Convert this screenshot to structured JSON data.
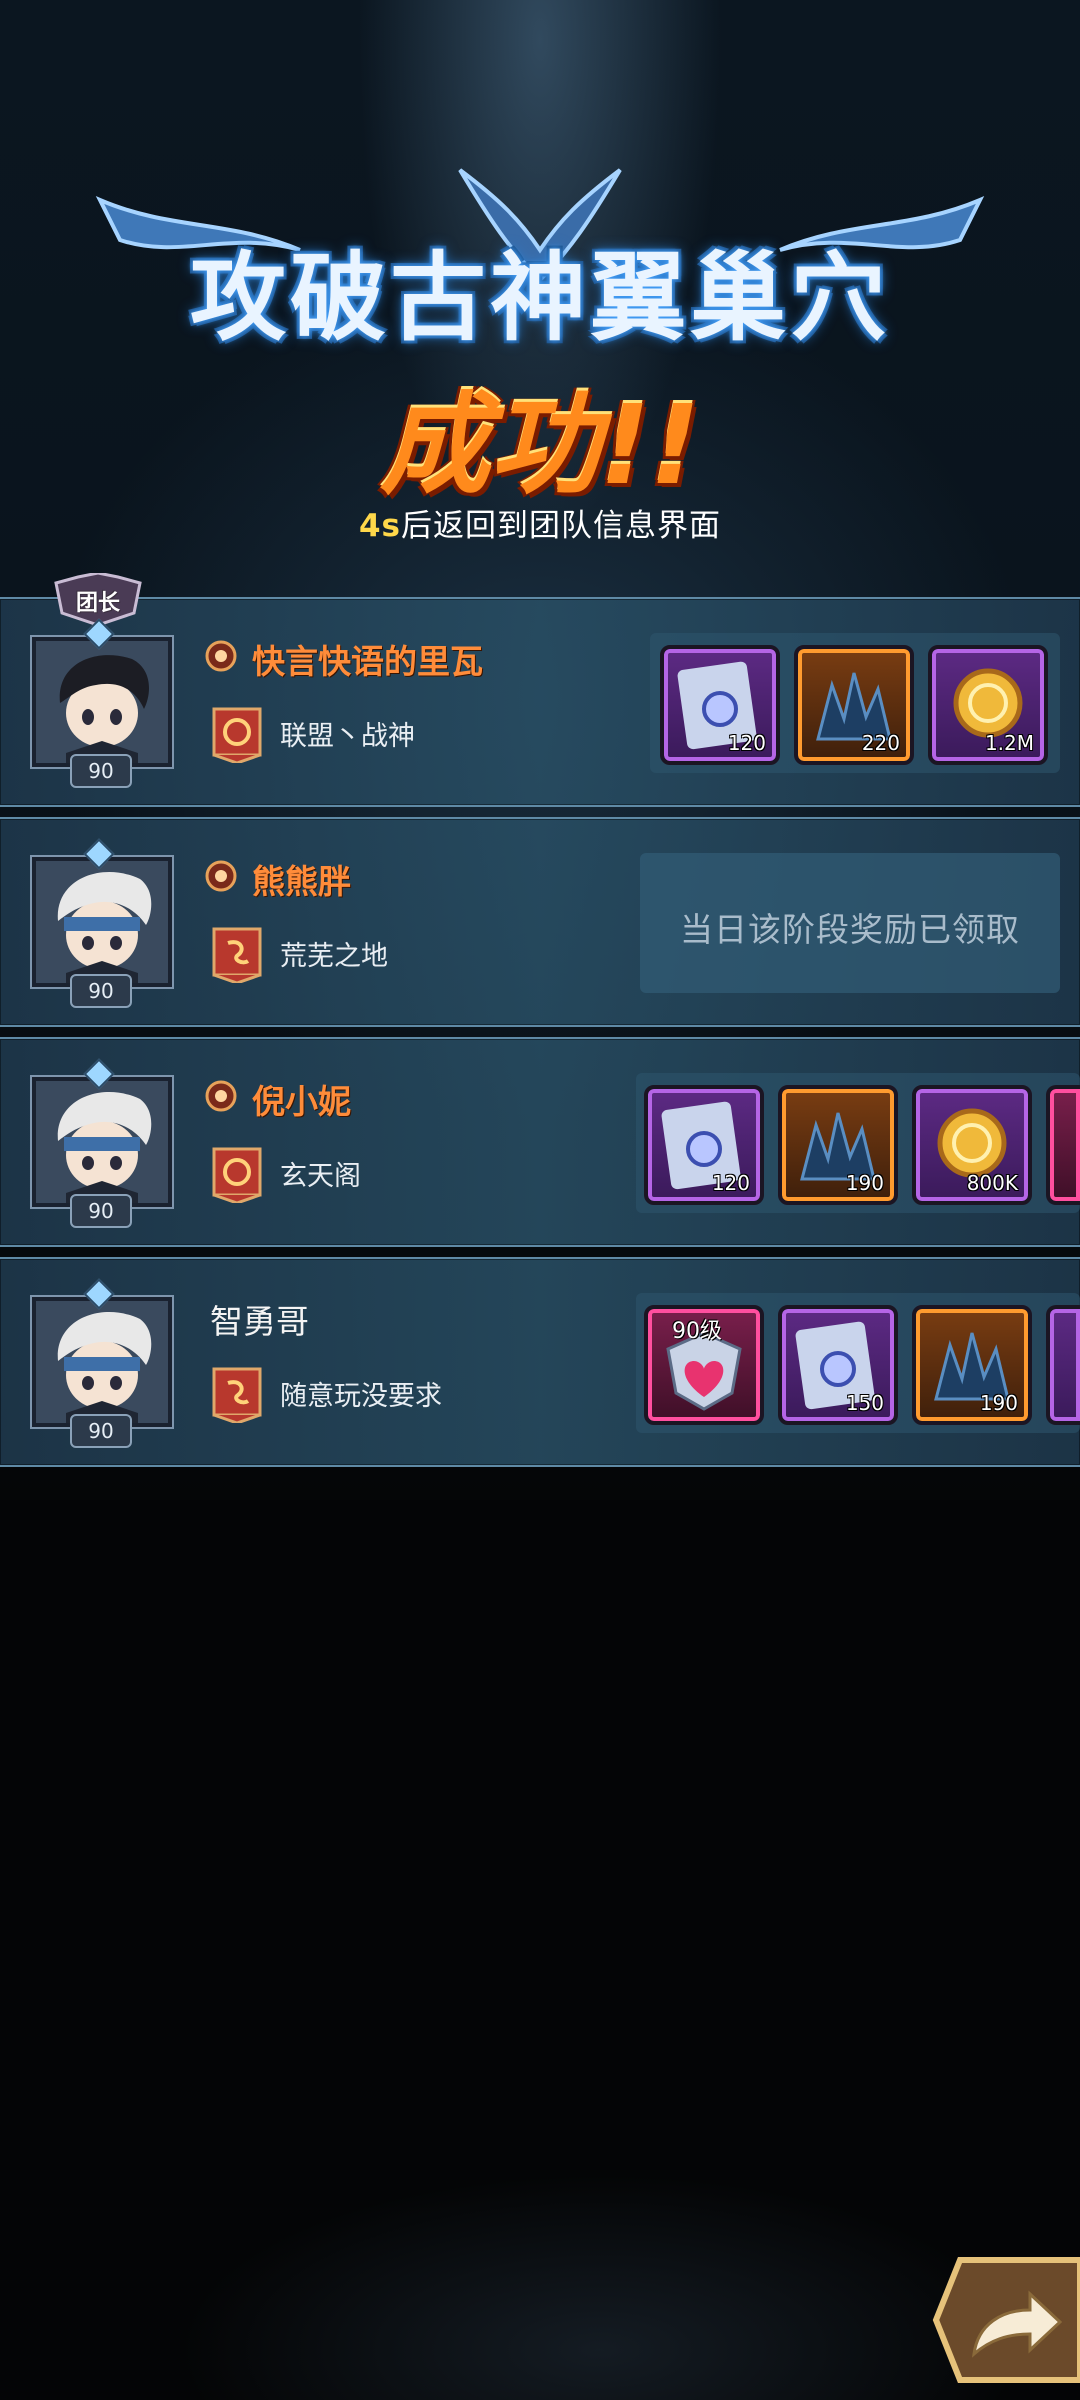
{
  "header": {
    "title": "攻破古神翼巢穴",
    "result": "成功!!",
    "countdown_seconds": "4s",
    "countdown_text": "后返回到团队信息界面"
  },
  "leader_badge": "团长",
  "players": [
    {
      "name": "快言快语的里瓦",
      "guild": "联盟丶战神",
      "level": "90",
      "rewards": [
        {
          "icon": "blueprint-scroll-icon",
          "qty": "120",
          "rarity": "purple"
        },
        {
          "icon": "dark-crystal-icon",
          "qty": "220",
          "rarity": "orange"
        },
        {
          "icon": "gold-coin-icon",
          "qty": "1.2M",
          "rarity": "purple"
        }
      ]
    },
    {
      "name": "熊熊胖",
      "guild": "荒芜之地",
      "level": "90",
      "claimed_text": "当日该阶段奖励已领取"
    },
    {
      "name": "倪小妮",
      "guild": "玄天阁",
      "level": "90",
      "rewards": [
        {
          "icon": "blueprint-scroll-icon",
          "qty": "120",
          "rarity": "purple"
        },
        {
          "icon": "dark-crystal-icon",
          "qty": "190",
          "rarity": "orange"
        },
        {
          "icon": "gold-coin-icon",
          "qty": "800K",
          "rarity": "purple"
        }
      ]
    },
    {
      "name": "智勇哥",
      "guild": "随意玩没要求",
      "level": "90",
      "rewards": [
        {
          "icon": "heart-equipment-icon",
          "level_tag": "90级",
          "rarity": "pink"
        },
        {
          "icon": "blueprint-scroll-icon",
          "qty": "150",
          "rarity": "purple"
        },
        {
          "icon": "dark-crystal-icon",
          "qty": "190",
          "rarity": "orange"
        }
      ]
    }
  ],
  "colors": {
    "title_glow": "#4aa6ff",
    "success_orange": "#ff8a1c",
    "countdown_seconds": "#ffd84a",
    "player_name": "#ff8c3a"
  }
}
